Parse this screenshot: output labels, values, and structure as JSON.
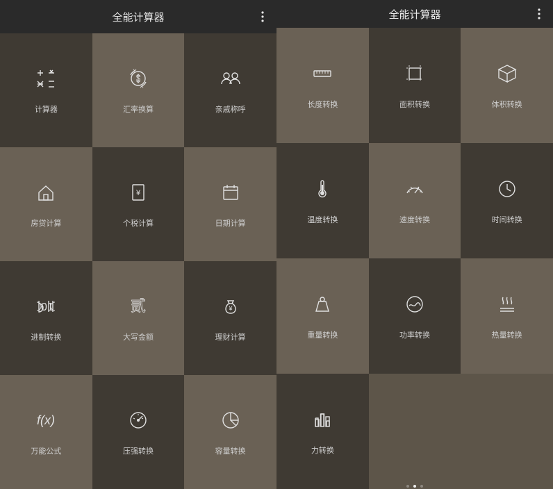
{
  "left": {
    "title": "全能计算器",
    "tiles": [
      {
        "id": "calculator",
        "icon": "calc",
        "label": "计算器",
        "shade": "dark"
      },
      {
        "id": "exchange",
        "icon": "exchange",
        "label": "汇率换算",
        "shade": "light"
      },
      {
        "id": "relatives",
        "icon": "relatives",
        "label": "亲戚称呼",
        "shade": "dark"
      },
      {
        "id": "mortgage",
        "icon": "house",
        "label": "房贷计算",
        "shade": "light"
      },
      {
        "id": "tax",
        "icon": "receipt",
        "label": "个税计算",
        "shade": "dark"
      },
      {
        "id": "date",
        "icon": "calendar",
        "label": "日期计算",
        "shade": "light"
      },
      {
        "id": "radix",
        "icon": "radix",
        "label": "进制转换",
        "shade": "dark"
      },
      {
        "id": "upper-amount",
        "icon": "hanzi",
        "label": "大写金额",
        "shade": "light"
      },
      {
        "id": "finance",
        "icon": "moneybag",
        "label": "理财计算",
        "shade": "dark"
      },
      {
        "id": "formula",
        "icon": "fx",
        "label": "万能公式",
        "shade": "light"
      },
      {
        "id": "pressure",
        "icon": "gauge",
        "label": "压强转换",
        "shade": "dark"
      },
      {
        "id": "capacity",
        "icon": "pie",
        "label": "容量转换",
        "shade": "light"
      }
    ]
  },
  "right": {
    "title": "全能计算器",
    "tiles": [
      {
        "id": "length",
        "icon": "ruler",
        "label": "长度转换",
        "shade": "light"
      },
      {
        "id": "area",
        "icon": "area",
        "label": "面积转换",
        "shade": "dark"
      },
      {
        "id": "volume",
        "icon": "cube",
        "label": "体积转换",
        "shade": "light"
      },
      {
        "id": "temp",
        "icon": "thermo",
        "label": "温度转换",
        "shade": "dark"
      },
      {
        "id": "speed",
        "icon": "speed",
        "label": "速度转换",
        "shade": "light"
      },
      {
        "id": "time",
        "icon": "clock",
        "label": "时间转换",
        "shade": "dark"
      },
      {
        "id": "weight",
        "icon": "weight",
        "label": "重量转换",
        "shade": "light"
      },
      {
        "id": "power",
        "icon": "power",
        "label": "功率转换",
        "shade": "dark"
      },
      {
        "id": "heat",
        "icon": "heat",
        "label": "热量转换",
        "shade": "light"
      },
      {
        "id": "force",
        "icon": "bars",
        "label": "力转换",
        "shade": "dark"
      },
      {
        "id": "empty1",
        "icon": "",
        "label": "",
        "shade": "light",
        "empty": true
      },
      {
        "id": "empty2",
        "icon": "",
        "label": "",
        "shade": "dark",
        "empty": true
      }
    ]
  }
}
